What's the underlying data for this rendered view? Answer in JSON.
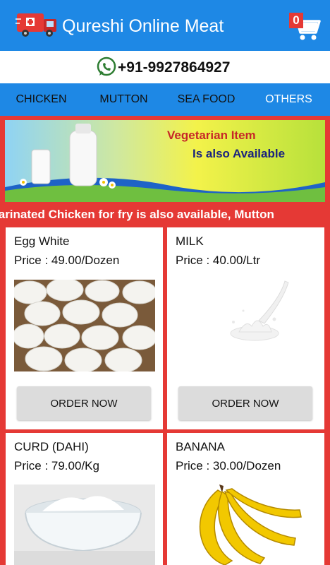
{
  "app": {
    "title": "Qureshi Online Meat",
    "cart_count": "0"
  },
  "contact": {
    "phone": "+91-9927864927"
  },
  "tabs": [
    {
      "label": "CHICKEN"
    },
    {
      "label": "MUTTON"
    },
    {
      "label": "SEA FOOD"
    },
    {
      "label": "OTHERS"
    }
  ],
  "banner": {
    "line1": "Vegetarian Item",
    "line2": "Is also Available"
  },
  "marquee": {
    "text": "Special:- Marinated Chicken for fry is also available, Mutton"
  },
  "products": [
    {
      "name": "Egg White",
      "price": "Price : 49.00/Dozen",
      "button": "ORDER NOW"
    },
    {
      "name": "MILK",
      "price": "Price : 40.00/Ltr",
      "button": "ORDER NOW"
    },
    {
      "name": "CURD (DAHI)",
      "price": "Price : 79.00/Kg"
    },
    {
      "name": "BANANA",
      "price": "Price : 30.00/Dozen"
    }
  ],
  "colors": {
    "primary": "#1e88e5",
    "accent": "#e53935",
    "button": "#dcdcdc"
  }
}
